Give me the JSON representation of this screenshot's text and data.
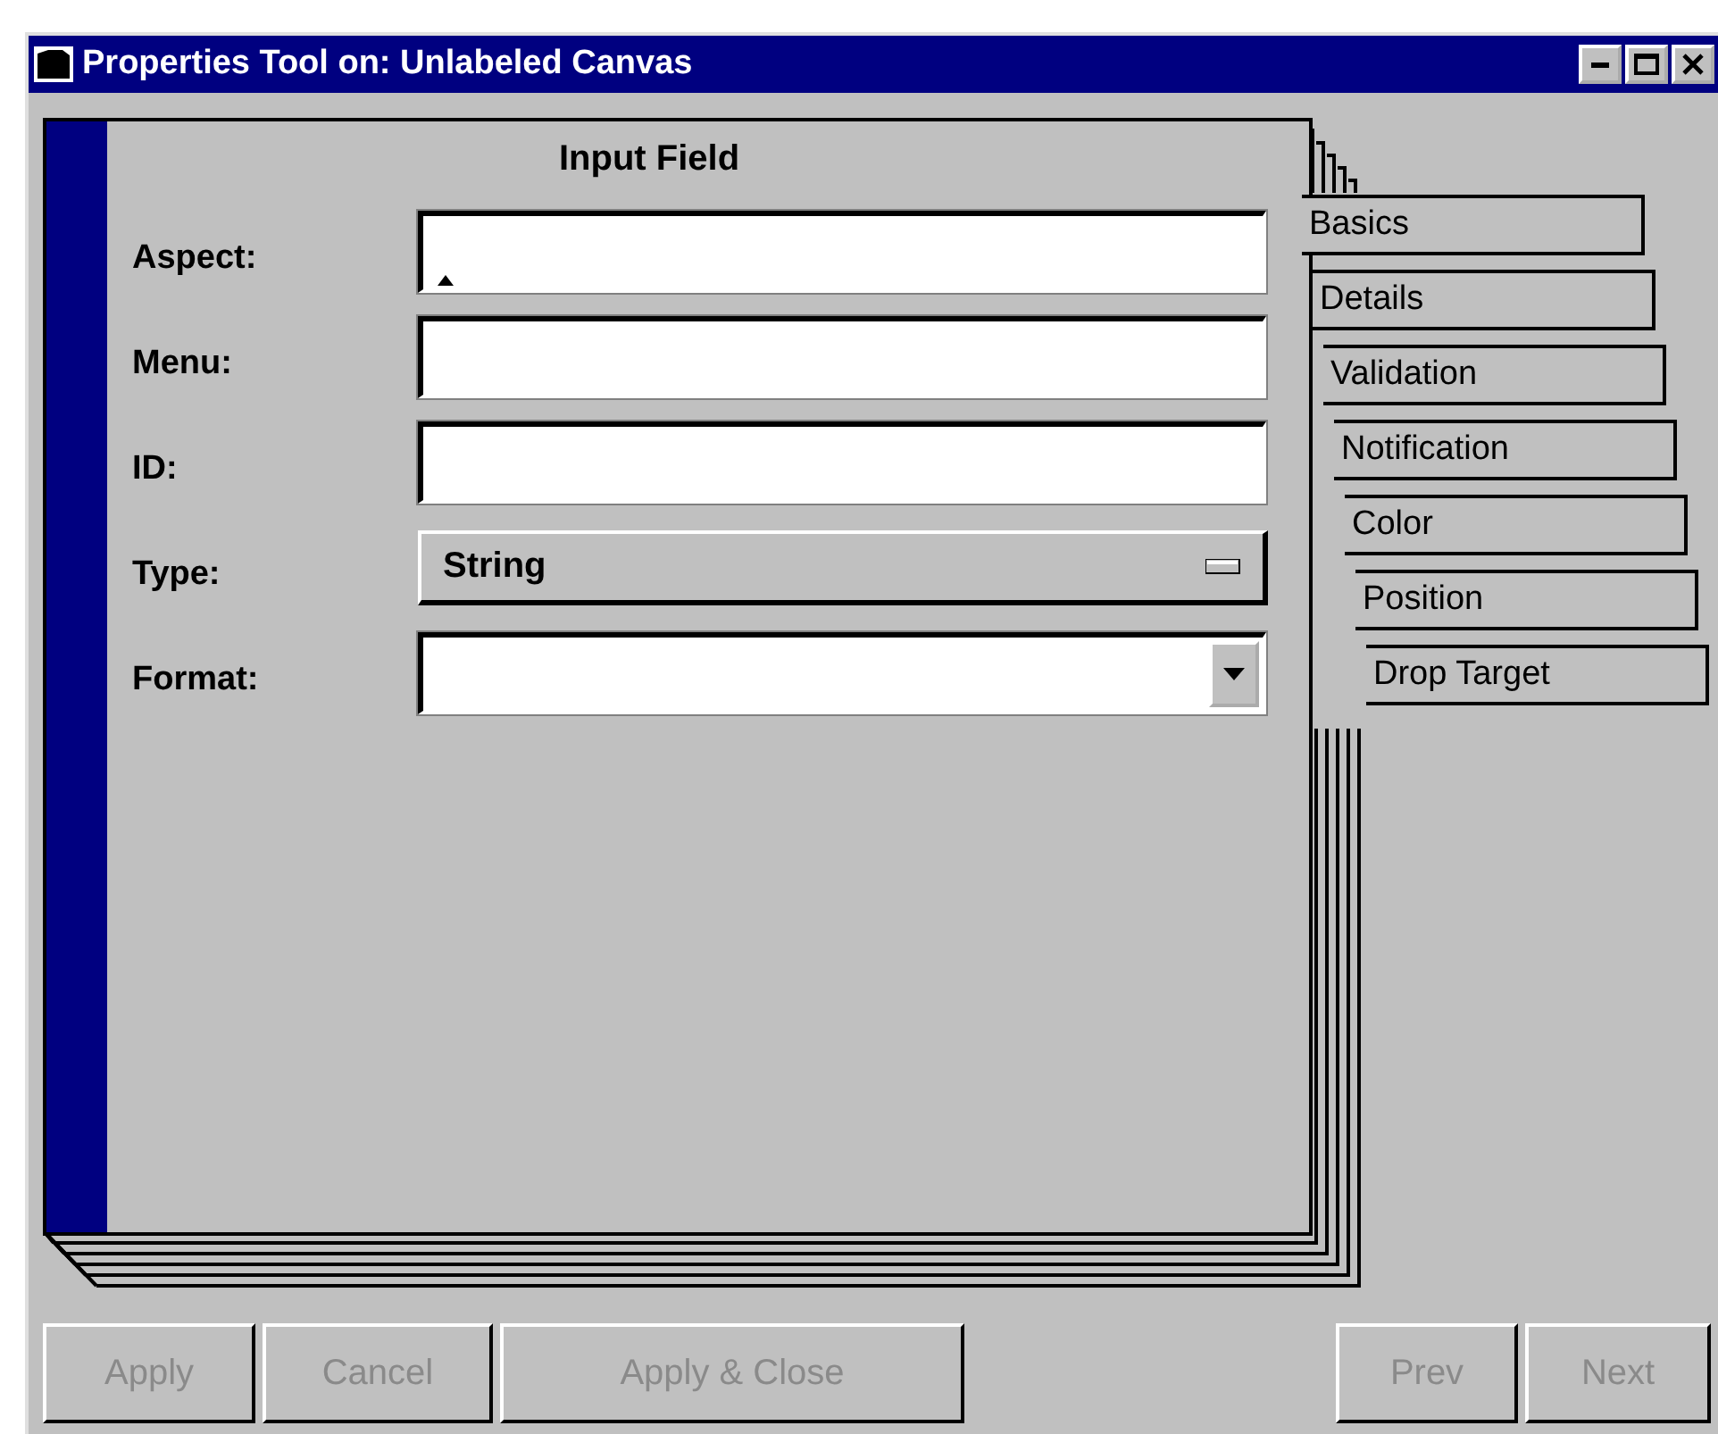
{
  "window": {
    "title": "Properties Tool on: Unlabeled Canvas"
  },
  "page": {
    "title": "Input Field",
    "fields": [
      {
        "label": "Aspect:",
        "kind": "text"
      },
      {
        "label": "Menu:",
        "kind": "text"
      },
      {
        "label": "ID:",
        "kind": "text"
      },
      {
        "label": "Type:",
        "kind": "option",
        "value": "String"
      },
      {
        "label": "Format:",
        "kind": "combo"
      }
    ]
  },
  "tabs": [
    {
      "label": "Basics"
    },
    {
      "label": "Details"
    },
    {
      "label": "Validation"
    },
    {
      "label": "Notification"
    },
    {
      "label": "Color"
    },
    {
      "label": "Position"
    },
    {
      "label": "Drop Target"
    }
  ],
  "buttons_left": [
    {
      "label": "Apply",
      "disabled": true
    },
    {
      "label": "Cancel",
      "disabled": true
    },
    {
      "label": "Apply & Close",
      "disabled": true
    }
  ],
  "buttons_right": [
    {
      "label": "Prev",
      "disabled": true
    },
    {
      "label": "Next",
      "disabled": true
    }
  ]
}
